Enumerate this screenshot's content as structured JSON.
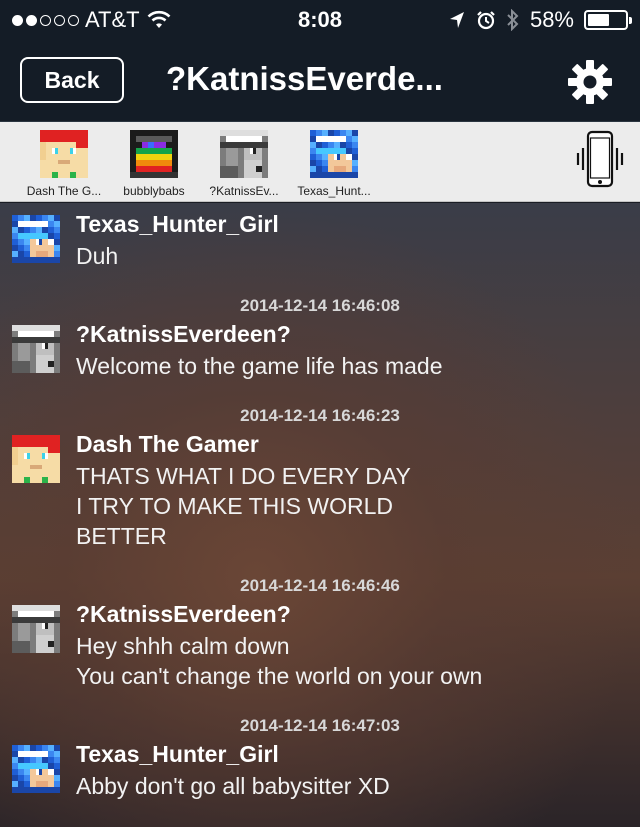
{
  "status_bar": {
    "carrier": "AT&T",
    "time": "8:08",
    "battery": "58%",
    "battery_level": 0.58,
    "signal_bars": 2
  },
  "nav": {
    "back_label": "Back",
    "title": "?KatnissEverdeen?",
    "title_display": "?KatnissEverde..."
  },
  "members": [
    {
      "name": "Dash The G...",
      "avatar": "dash"
    },
    {
      "name": "bubblybabs",
      "avatar": "bubbly"
    },
    {
      "name": "?KatnissEv...",
      "avatar": "katniss"
    },
    {
      "name": "Texas_Hunt...",
      "avatar": "texas"
    }
  ],
  "messages": [
    {
      "sender": "Texas_Hunter_Girl",
      "avatar": "texas",
      "text": "Duh"
    },
    {
      "timestamp": "2014-12-14 16:46:08",
      "sender": "?KatnissEverdeen?",
      "avatar": "katniss",
      "text": "Welcome to the game life has made"
    },
    {
      "timestamp": "2014-12-14 16:46:23",
      "sender": "Dash The Gamer",
      "avatar": "dash",
      "text": "THATS WHAT I DO EVERY DAY\nI TRY TO MAKE THIS WORLD\nBETTER"
    },
    {
      "timestamp": "2014-12-14 16:46:46",
      "sender": "?KatnissEverdeen?",
      "avatar": "katniss",
      "text": "Hey shhh calm down\nYou can't change the world on your own"
    },
    {
      "timestamp": "2014-12-14 16:47:03",
      "sender": "Texas_Hunter_Girl",
      "avatar": "texas",
      "text": "Abby don't go all babysitter XD"
    }
  ],
  "icons": {
    "settings": "gear-icon",
    "vibrate": "vibrate-phone-icon",
    "wifi": "wifi-icon",
    "location": "location-arrow-icon",
    "alarm": "alarm-icon",
    "bluetooth": "bluetooth-icon"
  }
}
